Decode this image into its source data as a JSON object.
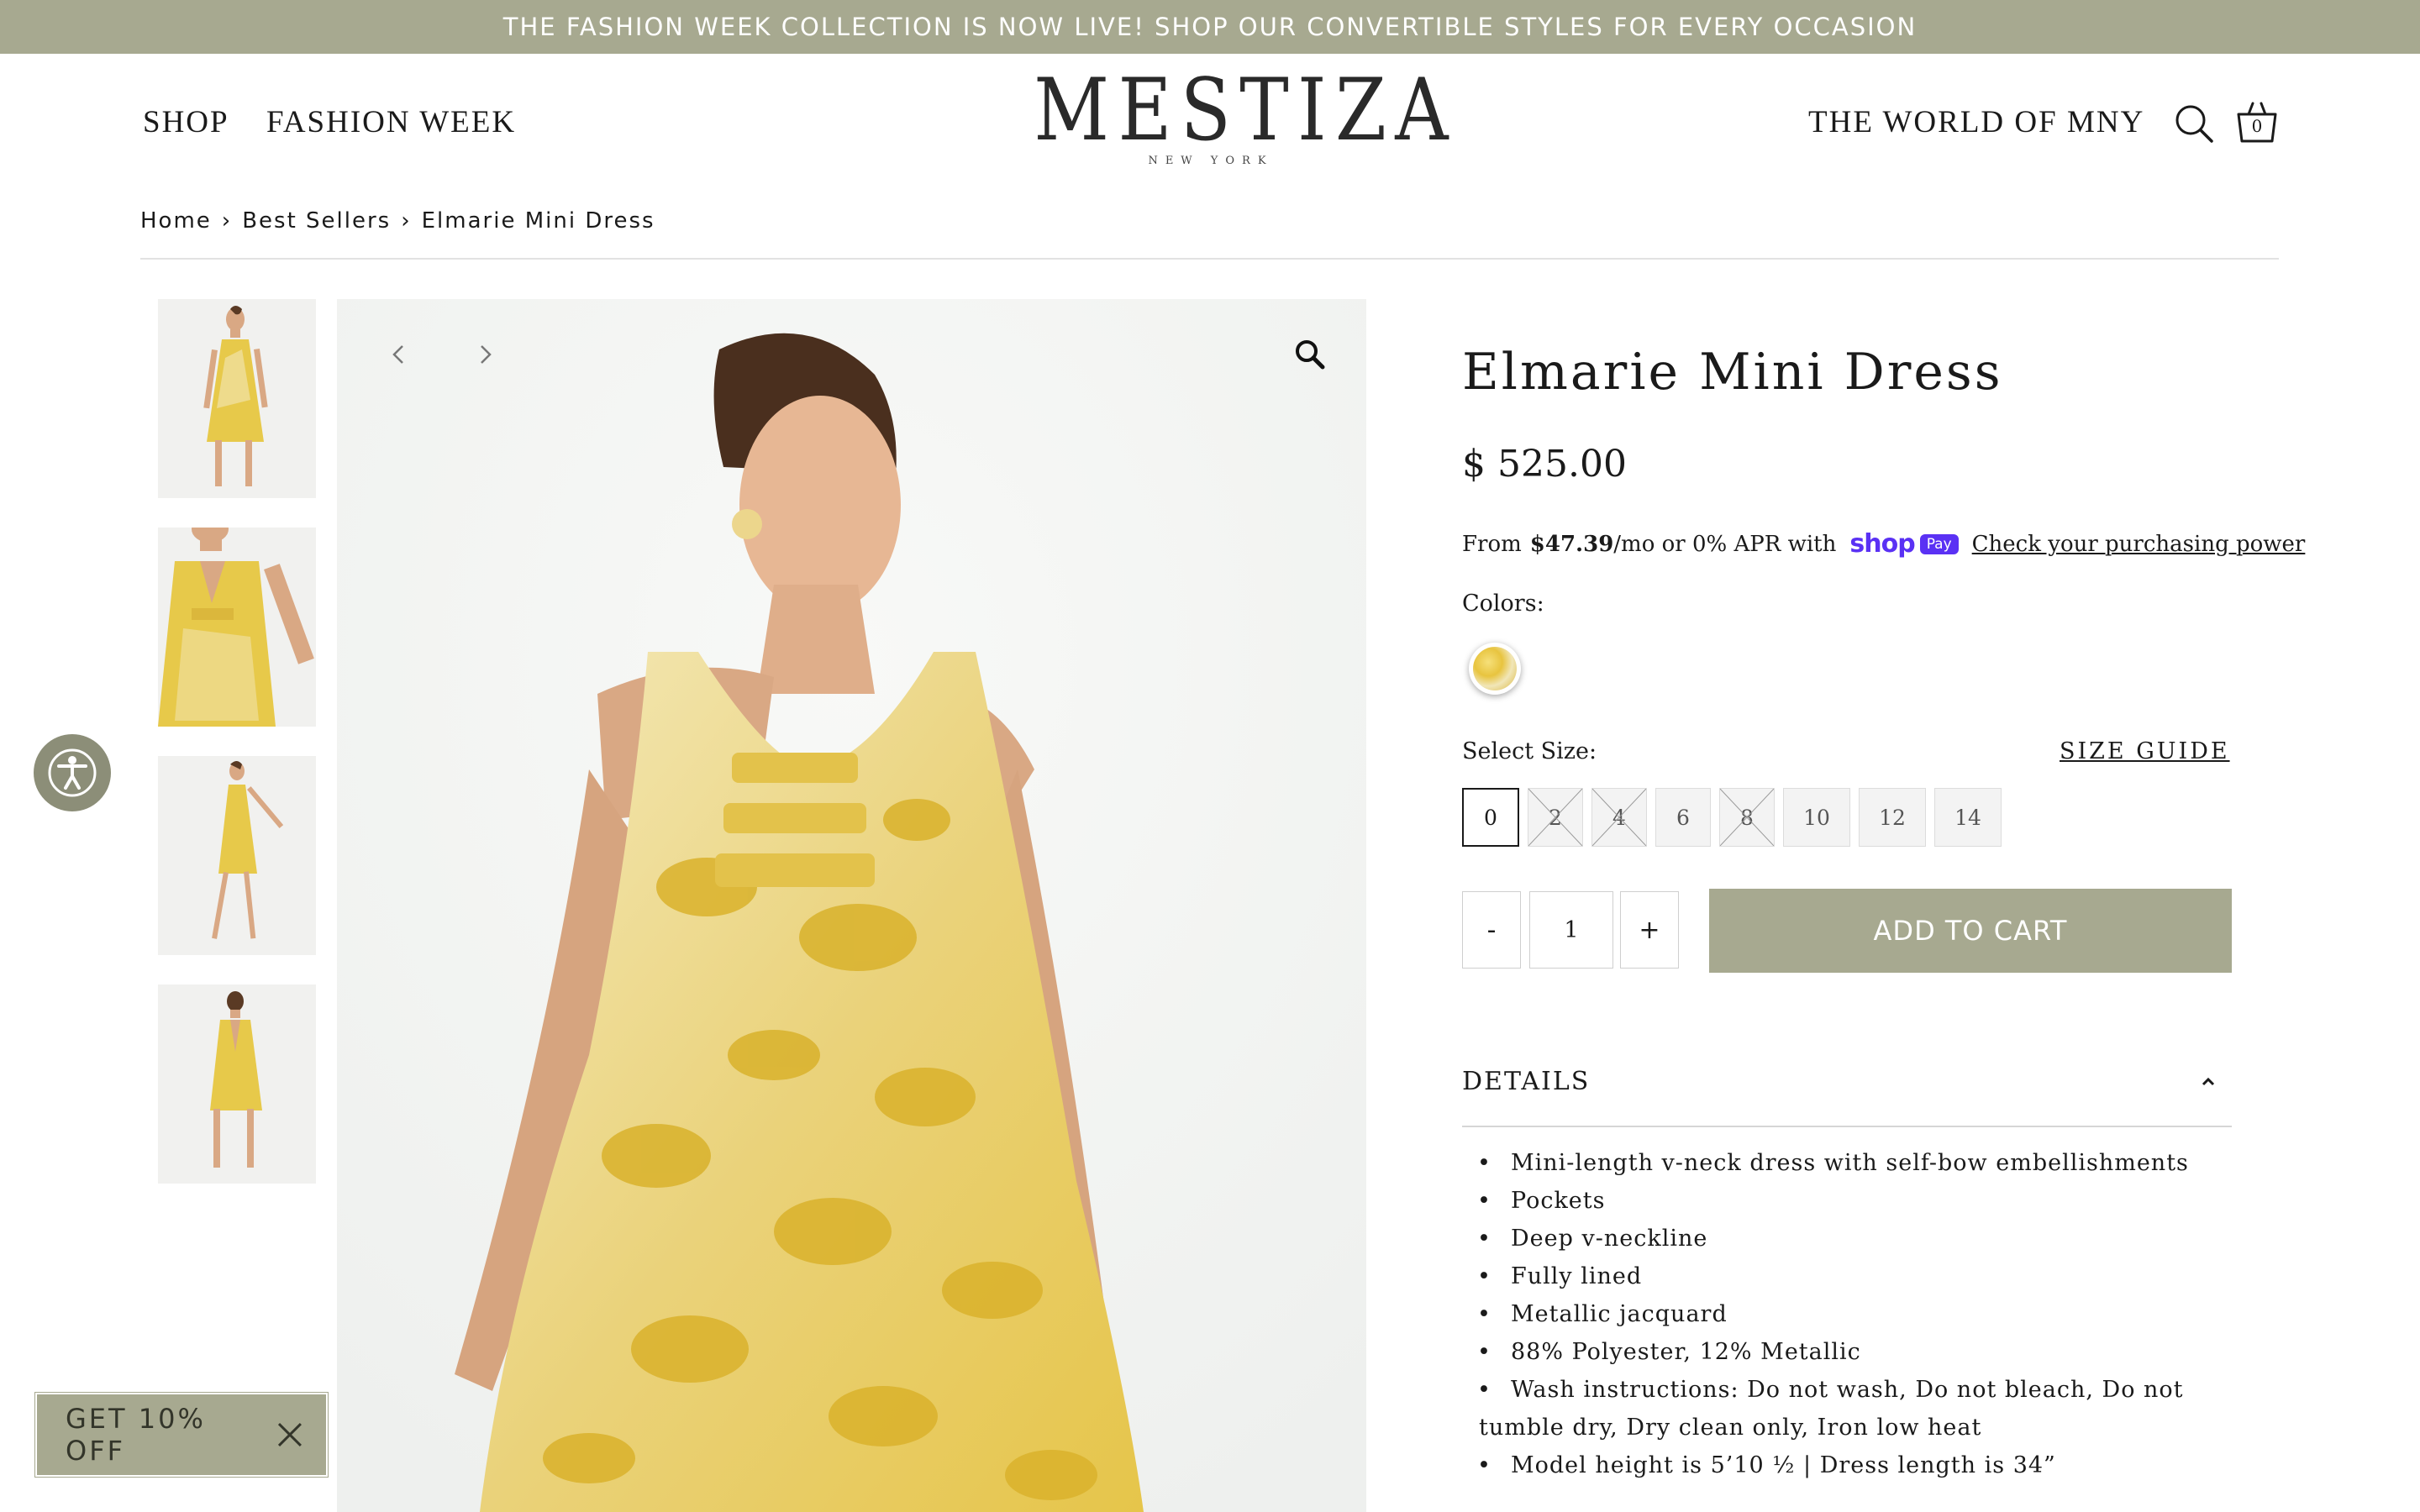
{
  "announcement": "THE FASHION WEEK COLLECTION IS NOW LIVE! SHOP OUR CONVERTIBLE STYLES FOR EVERY OCCASION",
  "nav": {
    "shop": "SHOP",
    "fashion_week": "FASHION WEEK",
    "world": "THE WORLD OF MNY",
    "cart_count": "0"
  },
  "logo": {
    "name": "MESTIZA",
    "sub": "NEW YORK"
  },
  "breadcrumb": {
    "home": "Home",
    "sep": "›",
    "category": "Best Sellers",
    "current": "Elmarie Mini Dress"
  },
  "gallery": {
    "thumbnails": [
      "front",
      "detail",
      "side",
      "back"
    ]
  },
  "product": {
    "title": "Elmarie Mini Dress",
    "price": "$ 525.00",
    "installments": {
      "prefix": "From",
      "amount": "$47.39",
      "suffix": "/mo or 0% APR with",
      "shop_wordmark": "shop",
      "shop_pill": "Pay",
      "link": "Check your purchasing power"
    },
    "colors_label": "Colors:",
    "size_label": "Select Size:",
    "size_guide": "SIZE GUIDE",
    "sizes": [
      {
        "label": "0",
        "selected": true,
        "unavailable": false
      },
      {
        "label": "2",
        "selected": false,
        "unavailable": true
      },
      {
        "label": "4",
        "selected": false,
        "unavailable": true
      },
      {
        "label": "6",
        "selected": false,
        "unavailable": false
      },
      {
        "label": "8",
        "selected": false,
        "unavailable": true
      },
      {
        "label": "10",
        "selected": false,
        "unavailable": false
      },
      {
        "label": "12",
        "selected": false,
        "unavailable": false
      },
      {
        "label": "14",
        "selected": false,
        "unavailable": false
      }
    ],
    "qty_minus": "-",
    "qty_value": "1",
    "qty_plus": "+",
    "add_to_cart": "ADD TO CART",
    "details_title": "DETAILS",
    "details": [
      "Mini-length v-neck dress with self-bow embellishments",
      "Pockets",
      "Deep v-neckline",
      "Fully lined",
      "Metallic jacquard",
      "88% Polyester, 12% Metallic",
      "Wash instructions: Do not wash, Do not bleach, Do not tumble dry, Dry clean only, Iron low heat",
      "Model height is 5’10 ½ | Dress length is 34”"
    ]
  },
  "promo": {
    "label": "GET 10% OFF"
  },
  "colors": {
    "accent": "#a7a990",
    "shop_pay": "#5a31f4"
  }
}
